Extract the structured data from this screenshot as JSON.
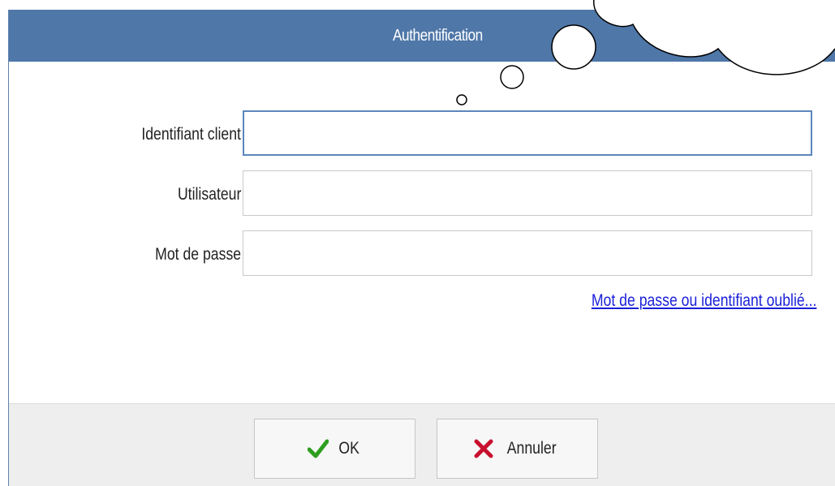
{
  "dialog": {
    "title": "Authentification"
  },
  "form": {
    "fields": [
      {
        "label": "Identifiant client",
        "value": "",
        "focused": true
      },
      {
        "label": "Utilisateur",
        "value": ""
      },
      {
        "label": "Mot de passe",
        "value": ""
      }
    ],
    "forgot_link": "Mot de passe ou identifiant oublié..."
  },
  "buttons": {
    "ok_label": "OK",
    "ok_icon": "checkmark-icon",
    "cancel_label": "Annuler",
    "cancel_icon": "cross-icon"
  },
  "colors": {
    "title_bar": "#4f77a8",
    "link": "#1a1fd8",
    "ok_icon": "#2e9e1f",
    "cancel_icon": "#c8102e",
    "footer": "#eeeeee"
  }
}
